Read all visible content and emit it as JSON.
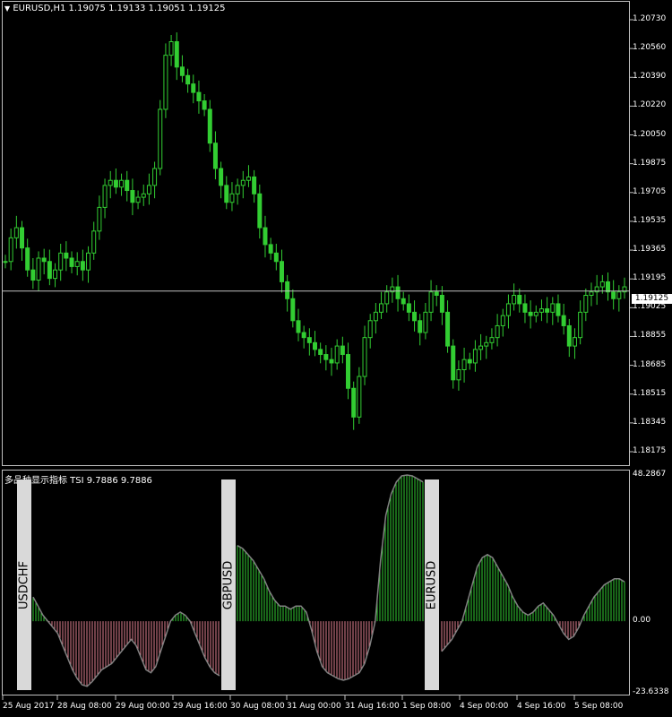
{
  "window": {
    "symbol_header": "EURUSD,H1  1.19075 1.19133 1.19051 1.19125",
    "indicator_header": "多品种显示指标 TSI 9.7886 9.7886"
  },
  "price_axis": {
    "ticks": [
      "1.20730",
      "1.20560",
      "1.20390",
      "1.20220",
      "1.20050",
      "1.19875",
      "1.19705",
      "1.19535",
      "1.19365",
      "1.19195",
      "1.19025",
      "1.18855",
      "1.18685",
      "1.18515",
      "1.18345",
      "1.18175"
    ],
    "current": "1.19125"
  },
  "indicator_axis": {
    "ticks": [
      "48.2867",
      "0.00",
      "-23.6338"
    ]
  },
  "time_axis": {
    "labels": [
      "25 Aug 2017",
      "28 Aug 08:00",
      "29 Aug 00:00",
      "29 Aug 16:00",
      "30 Aug 08:00",
      "31 Aug 00:00",
      "31 Aug 16:00",
      "1 Sep 08:00",
      "4 Sep 00:00",
      "4 Sep 16:00",
      "5 Sep 08:00"
    ]
  },
  "symbol_labels": [
    "USDCHF",
    "GBPUSD",
    "EURUSD"
  ],
  "colors": {
    "candle": "#32cd32",
    "positive_hist": "#32cd32",
    "negative_hist": "#e08090",
    "tsi_line": "#808080",
    "label_box": "#d9d9d9",
    "grid_line": "#c0c0c0"
  },
  "chart_data": [
    {
      "type": "line",
      "title": "EURUSD,H1",
      "ylim": [
        1.18175,
        1.2073
      ],
      "series": [
        {
          "name": "EURUSD",
          "values": [
            1.193,
            1.1944,
            1.195,
            1.1938,
            1.1925,
            1.1919,
            1.1932,
            1.193,
            1.192,
            1.1925,
            1.1935,
            1.1932,
            1.1927,
            1.193,
            1.1925,
            1.1935,
            1.1948,
            1.1962,
            1.1975,
            1.1978,
            1.1974,
            1.1978,
            1.1972,
            1.1965,
            1.1968,
            1.197,
            1.1975,
            1.1985,
            1.202,
            1.2052,
            1.206,
            1.2045,
            1.204,
            1.2035,
            1.203,
            1.2025,
            1.202,
            1.2,
            1.1985,
            1.1975,
            1.1965,
            1.197,
            1.1975,
            1.1978,
            1.198,
            1.197,
            1.195,
            1.194,
            1.1935,
            1.193,
            1.1918,
            1.1908,
            1.1895,
            1.1888,
            1.1885,
            1.1882,
            1.1878,
            1.1875,
            1.1872,
            1.187,
            1.188,
            1.1875,
            1.1855,
            1.1838,
            1.1862,
            1.1885,
            1.1895,
            1.19,
            1.1905,
            1.1912,
            1.1915,
            1.1908,
            1.1905,
            1.19,
            1.1895,
            1.1888,
            1.19,
            1.1912,
            1.191,
            1.19,
            1.188,
            1.186,
            1.1866,
            1.1872,
            1.187,
            1.1878,
            1.188,
            1.1882,
            1.1885,
            1.1892,
            1.1898,
            1.1905,
            1.191,
            1.1905,
            1.19,
            1.1898,
            1.19,
            1.1902,
            1.19,
            1.1905,
            1.1898,
            1.1892,
            1.188,
            1.1885,
            1.19,
            1.191,
            1.1912,
            1.1915,
            1.1918,
            1.1912,
            1.1908,
            1.1912,
            1.1915
          ]
        }
      ]
    },
    {
      "type": "bar",
      "title": "多品种显示指标 TSI",
      "ylim": [
        -23.6338,
        48.2867
      ],
      "series": [
        {
          "name": "USDCHF",
          "values": [
            8,
            5,
            2,
            0,
            -2,
            -4,
            -8,
            -12,
            -16,
            -19,
            -21,
            -21.5,
            -20,
            -18,
            -16,
            -15,
            -14,
            -12,
            -10,
            -8,
            -6,
            -8,
            -12,
            -16,
            -17,
            -15,
            -10,
            -5,
            0,
            2,
            3,
            2,
            0,
            -4,
            -8,
            -12,
            -15,
            -17,
            -18
          ]
        },
        {
          "name": "GBPUSD",
          "values": [
            25,
            24,
            22,
            20,
            17,
            14,
            10,
            7,
            5,
            5,
            4,
            5,
            5,
            3,
            -3,
            -10,
            -15,
            -17,
            -18,
            -19,
            -19.5,
            -19,
            -18,
            -17,
            -14,
            -8,
            0,
            20,
            35,
            42,
            46,
            48,
            48.2867,
            48,
            47,
            46
          ]
        },
        {
          "name": "EURUSD",
          "values": [
            -10,
            -8,
            -6,
            -3,
            0,
            6,
            12,
            18,
            21,
            22,
            21,
            18,
            15,
            12,
            8,
            5,
            3,
            2,
            3,
            5,
            6,
            4,
            2,
            -1,
            -4,
            -6,
            -5,
            -2,
            2,
            5,
            8,
            10,
            12,
            13,
            14,
            14,
            13
          ]
        }
      ]
    }
  ]
}
